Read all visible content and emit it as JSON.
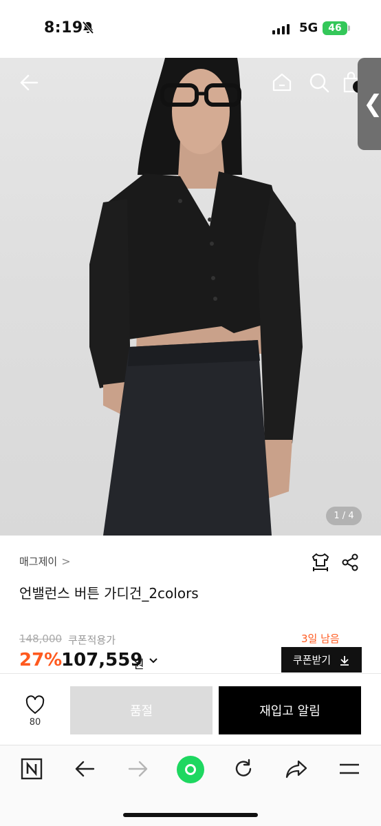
{
  "status": {
    "time": "8:19",
    "network": "5G",
    "battery": "46"
  },
  "gallery": {
    "pager": "1 / 4"
  },
  "product": {
    "brand": "매그제이",
    "brand_chevron": ">",
    "title": "언밸런스 버튼 가디건_2colors",
    "original_price": "148,000",
    "coupon_note": "쿠폰적용가",
    "days_left": "3일 남음",
    "discount": "27%",
    "price": "107,559",
    "currency": "원"
  },
  "coupon_button": {
    "label": "쿠폰받기"
  },
  "actions": {
    "wish_count": "80",
    "soldout_label": "품절",
    "restock_label": "재입고 알림"
  },
  "colors": {
    "accent": "#ff5a1f",
    "dark": "#111111",
    "soldout": "#dcdcdc",
    "battery": "#34c759",
    "browser_green": "#1ed760"
  },
  "icons": [
    "back-arrow-icon",
    "home-icon",
    "search-icon",
    "bag-icon",
    "handle-chevron-icon",
    "size-guide-icon",
    "share-icon",
    "heart-icon",
    "download-icon",
    "n-logo-icon",
    "browser-back-icon",
    "browser-forward-icon",
    "green-orb-icon",
    "refresh-icon",
    "share-forward-icon",
    "menu-icon"
  ]
}
